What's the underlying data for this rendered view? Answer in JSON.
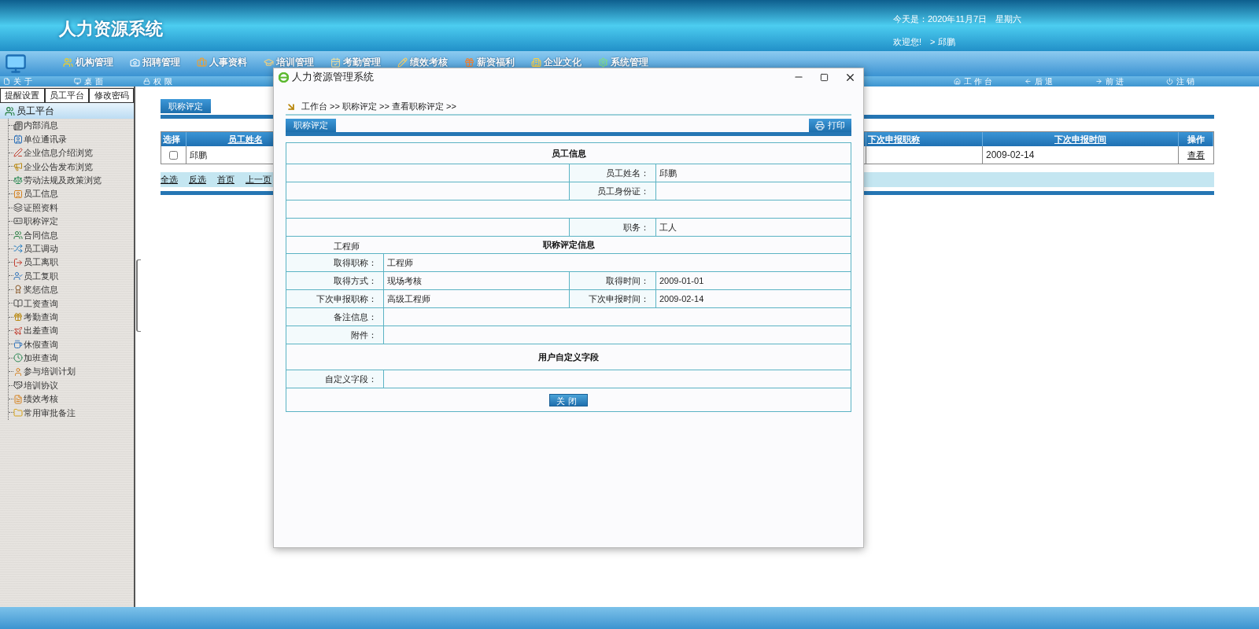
{
  "header": {
    "title": "人力资源系统",
    "date": "今天是：2020年11月7日　星期六",
    "welcome": "欢迎您!　> 邱鹏"
  },
  "nav": [
    {
      "label": "机构管理"
    },
    {
      "label": "招聘管理"
    },
    {
      "label": "人事资料"
    },
    {
      "label": "培训管理"
    },
    {
      "label": "考勤管理"
    },
    {
      "label": "绩效考核"
    },
    {
      "label": "薪资福利"
    },
    {
      "label": "企业文化"
    },
    {
      "label": "系统管理"
    }
  ],
  "subbar_left": [
    {
      "label": "关于"
    },
    {
      "label": "桌面"
    },
    {
      "label": "权限"
    }
  ],
  "subbar_right": [
    {
      "label": "工作台"
    },
    {
      "label": "后退"
    },
    {
      "label": "前进"
    },
    {
      "label": "注销"
    }
  ],
  "sidebar": {
    "tabs": [
      {
        "label": "提醒设置"
      },
      {
        "label": "员工平台"
      },
      {
        "label": "修改密码"
      }
    ],
    "root": "员工平台",
    "items": [
      "内部消息",
      "单位通讯录",
      "企业信息介绍浏览",
      "企业公告发布浏览",
      "劳动法规及政策浏览",
      "员工信息",
      "证照资料",
      "职称评定",
      "合同信息",
      "员工调动",
      "员工离职",
      "员工复职",
      "奖惩信息",
      "工资查询",
      "考勤查询",
      "出差查询",
      "休假查询",
      "加班查询",
      "参与培训计划",
      "培训协议",
      "绩效考核",
      "常用审批备注"
    ]
  },
  "main": {
    "tab": "职称评定",
    "table": {
      "columns": [
        "选择",
        "员工姓名",
        "下次申报职称",
        "下次申报时间",
        "操作"
      ],
      "rows": [
        {
          "checked": false,
          "name": "邱鹏",
          "next_date": "2009-02-14",
          "action": "查看"
        }
      ]
    },
    "pager": [
      "全选",
      "反选",
      "首页",
      "上一页"
    ]
  },
  "dialog": {
    "title": "人力资源管理系统",
    "breadcrumb": "工作台 >> 职称评定 >> 查看职称评定 >>",
    "tab": "职称评定",
    "print_button": "打印",
    "rows": [
      {
        "kind": "section",
        "title": "员工信息"
      },
      {
        "kind": "right",
        "label": "员工姓名：",
        "value": "邱鹏"
      },
      {
        "kind": "right",
        "label": "员工身份证："
      },
      {
        "kind": "blank"
      },
      {
        "kind": "right",
        "label": "职务：",
        "value": "工人"
      },
      {
        "kind": "section",
        "title": "职称评定信息",
        "side_text": "工程师"
      },
      {
        "kind": "single",
        "label": "取得职称：",
        "value": "工程师"
      },
      {
        "kind": "pair",
        "label": "取得方式：",
        "value": "现场考核",
        "label2": "取得时间：",
        "value2": "2009-01-01"
      },
      {
        "kind": "pair",
        "label": "下次申报职称：",
        "value": "高级工程师",
        "label2": "下次申报时间：",
        "value2": "2009-02-14"
      },
      {
        "kind": "single",
        "label": "备注信息："
      },
      {
        "kind": "single",
        "label": "附件："
      },
      {
        "kind": "section",
        "title": "用户自定义字段"
      },
      {
        "kind": "single",
        "label": "自定义字段："
      },
      {
        "kind": "button",
        "label": "关闭"
      }
    ]
  }
}
